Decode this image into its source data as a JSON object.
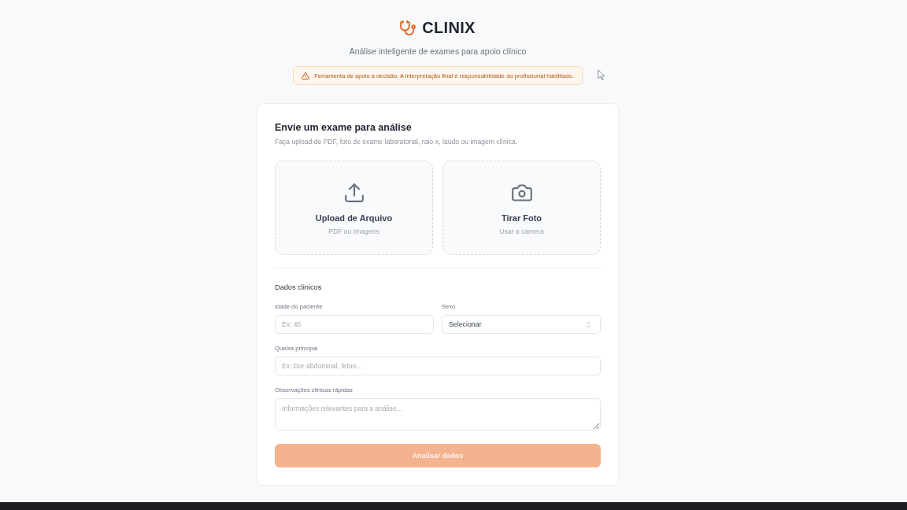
{
  "header": {
    "brand": "CLINIX",
    "tagline": "Análise inteligente de exames para apoio clínico",
    "notice": "Ferramenta de apoio à decisão. A interpretação final é responsabilidade do profissional habilitado."
  },
  "upload_card": {
    "title": "Envie um exame para análise",
    "description": "Faça upload de PDF, foto de exame laboratorial, raio-x, laudo ou imagem clínica.",
    "options": [
      {
        "kind": "upload",
        "title": "Upload de Arquivo",
        "subtitle": "PDF ou Imagens"
      },
      {
        "kind": "camera",
        "title": "Tirar Foto",
        "subtitle": "Usar a camera"
      }
    ]
  },
  "clinical_data": {
    "heading": "Dados clinicos",
    "rows": [
      [
        {
          "kind": "input",
          "label": "Idade do paciente",
          "placeholder": "Ex: 45"
        },
        {
          "kind": "select",
          "label": "Sexo",
          "value": "Selecionar"
        }
      ],
      [
        {
          "kind": "input",
          "label": "Queixa principal",
          "placeholder": "Ex: Dor abdominal, febre..."
        }
      ],
      [
        {
          "kind": "textarea",
          "label": "Observações clinicas rápidas",
          "placeholder": "Informações relevantes para a análise..."
        }
      ]
    ]
  },
  "submit": {
    "label": "Analisar dados",
    "disabled": true
  }
}
